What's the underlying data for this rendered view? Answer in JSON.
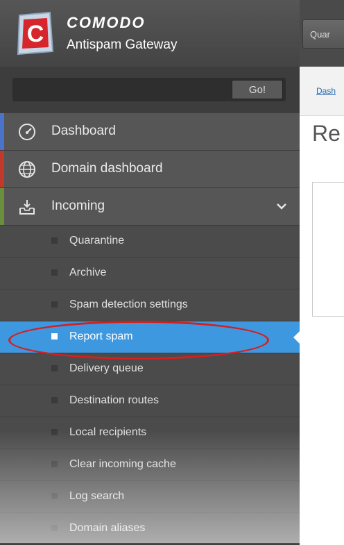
{
  "brand": {
    "name": "COMODO",
    "product": "Antispam Gateway"
  },
  "header": {
    "tab_label": "Quar"
  },
  "search": {
    "value": "",
    "placeholder": "",
    "go_label": "Go!"
  },
  "sidebar": {
    "main_items": [
      {
        "label": "Dashboard",
        "icon": "gauge-icon",
        "accent": "#4a74c9"
      },
      {
        "label": "Domain dashboard",
        "icon": "globe-icon",
        "accent": "#c0392b"
      },
      {
        "label": "Incoming",
        "icon": "inbox-icon",
        "accent": "#6b8e3a",
        "expanded": true
      }
    ],
    "sub_items": [
      {
        "label": "Quarantine"
      },
      {
        "label": "Archive"
      },
      {
        "label": "Spam detection settings"
      },
      {
        "label": "Report spam",
        "active": true
      },
      {
        "label": "Delivery queue"
      },
      {
        "label": "Destination routes"
      },
      {
        "label": "Local recipients"
      },
      {
        "label": "Clear incoming cache"
      },
      {
        "label": "Log search"
      },
      {
        "label": "Domain aliases"
      }
    ]
  },
  "content": {
    "breadcrumb": "Dash",
    "title": "Re"
  },
  "colors": {
    "active": "#3e98e0",
    "highlight": "#d32020",
    "sidebar": "#3d3d3d"
  }
}
